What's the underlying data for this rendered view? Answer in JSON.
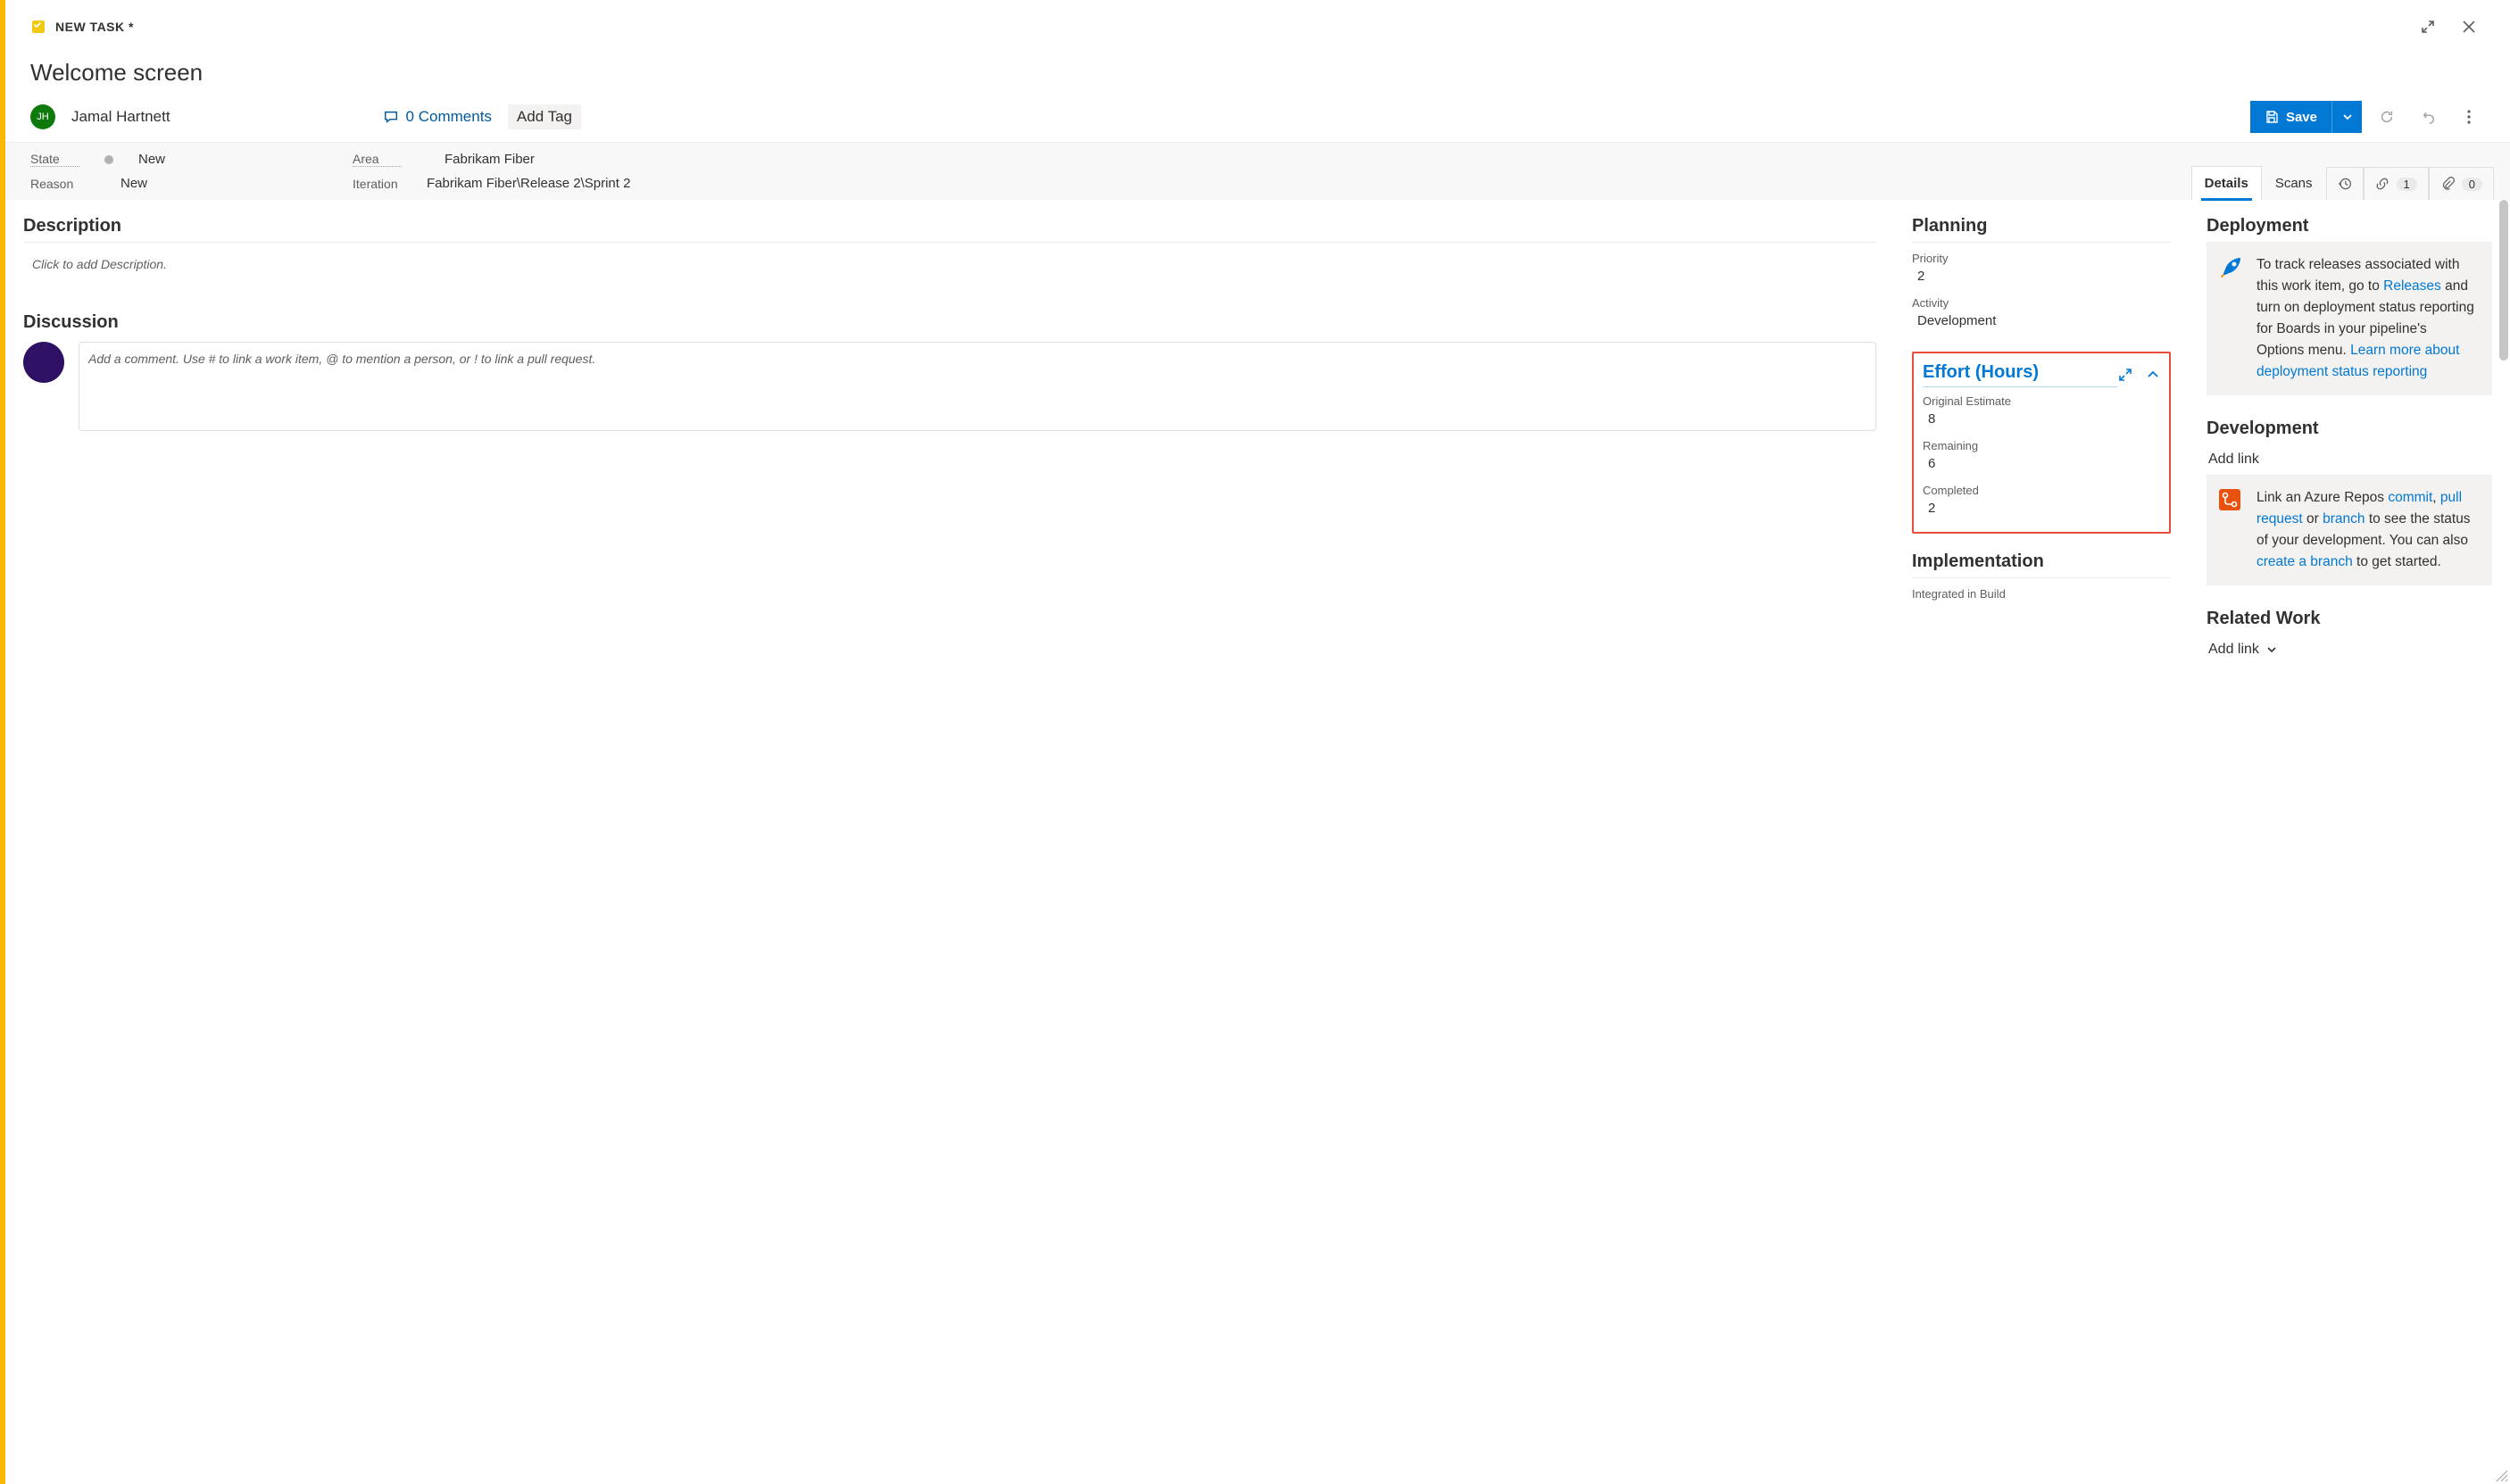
{
  "header": {
    "task_type": "NEW TASK *",
    "title": "Welcome screen",
    "assignee_initials": "JH",
    "assignee_name": "Jamal Hartnett",
    "comments_count": "0 Comments",
    "add_tag_label": "Add Tag",
    "save_label": "Save"
  },
  "meta": {
    "state_label": "State",
    "state_value": "New",
    "reason_label": "Reason",
    "reason_value": "New",
    "area_label": "Area",
    "area_value": "Fabrikam Fiber",
    "iteration_label": "Iteration",
    "iteration_value": "Fabrikam Fiber\\Release 2\\Sprint 2"
  },
  "tabs": {
    "details": "Details",
    "scans": "Scans",
    "links_count": "1",
    "attachments_count": "0"
  },
  "description": {
    "heading": "Description",
    "placeholder": "Click to add Description."
  },
  "discussion": {
    "heading": "Discussion",
    "placeholder": "Add a comment. Use # to link a work item, @ to mention a person, or ! to link a pull request."
  },
  "planning": {
    "heading": "Planning",
    "priority_label": "Priority",
    "priority_value": "2",
    "activity_label": "Activity",
    "activity_value": "Development"
  },
  "effort": {
    "heading": "Effort (Hours)",
    "original_label": "Original Estimate",
    "original_value": "8",
    "remaining_label": "Remaining",
    "remaining_value": "6",
    "completed_label": "Completed",
    "completed_value": "2"
  },
  "implementation": {
    "heading": "Implementation",
    "integrated_label": "Integrated in Build"
  },
  "deployment": {
    "heading": "Deployment",
    "text_part1": "To track releases associated with this work item, go to ",
    "link1": "Releases",
    "text_part2": " and turn on deployment status reporting for Boards in your pipeline's Options menu. ",
    "link2": "Learn more about deployment status reporting"
  },
  "development": {
    "heading": "Development",
    "add_link_label": "Add link",
    "text_part1": "Link an Azure Repos ",
    "link_commit": "commit",
    "sep1": ", ",
    "link_pr": "pull request",
    "sep2": " or ",
    "link_branch": "branch",
    "text_part2": " to see the status of your development. You can also ",
    "link_create": "create a branch",
    "text_part3": " to get started."
  },
  "related": {
    "heading": "Related Work",
    "add_link_label": "Add link"
  }
}
